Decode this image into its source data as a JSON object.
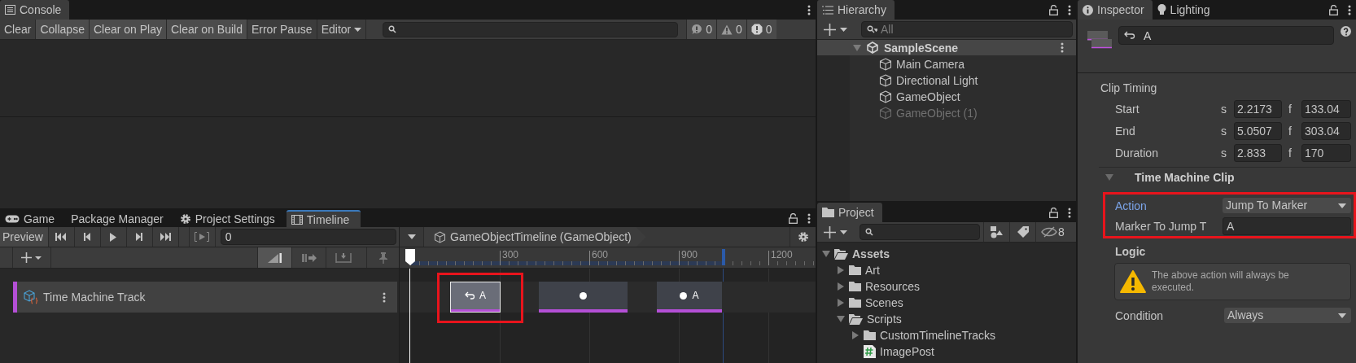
{
  "console": {
    "tab": "Console",
    "buttons": [
      {
        "label": "Clear",
        "on": false
      },
      {
        "label": "Collapse",
        "on": true
      },
      {
        "label": "Clear on Play",
        "on": true
      },
      {
        "label": "Clear on Build",
        "on": true
      },
      {
        "label": "Error Pause",
        "on": false
      }
    ],
    "editor": "Editor",
    "counts": [
      {
        "kind": "info",
        "count": "0"
      },
      {
        "kind": "warning",
        "count": "0"
      },
      {
        "kind": "error",
        "count": "0"
      }
    ]
  },
  "bottom_tabs": [
    {
      "label": "Game",
      "kind": "game",
      "selected": false
    },
    {
      "label": "Package Manager",
      "kind": "package",
      "selected": false
    },
    {
      "label": "Project Settings",
      "kind": "settings",
      "selected": false
    },
    {
      "label": "Timeline",
      "kind": "timeline",
      "selected": true
    }
  ],
  "timeline": {
    "preview": {
      "label": "Preview",
      "on": false
    },
    "time": "0",
    "asset": "GameObjectTimeline (GameObject)",
    "ruler_labels": [
      "300",
      "600",
      "900",
      "1200"
    ],
    "tracks": [
      {
        "name": "Time Machine Track",
        "color": "#b44fd6",
        "clips": [
          {
            "kind": "jump",
            "label": "A",
            "selected": true,
            "highlighted": true
          },
          {
            "kind": "marker",
            "selected": false,
            "highlighted": false
          },
          {
            "kind": "marker",
            "label": "A",
            "selected": false,
            "highlighted": false
          }
        ]
      }
    ]
  },
  "hierarchy": {
    "tab": "Hierarchy",
    "search": {
      "placeholder": "All"
    },
    "scene": {
      "name": "SampleScene",
      "expanded": true,
      "children": [
        {
          "name": "Main Camera",
          "disabled": false
        },
        {
          "name": "Directional Light",
          "disabled": false
        },
        {
          "name": "GameObject",
          "disabled": false
        },
        {
          "name": "GameObject (1)",
          "disabled": true
        }
      ]
    }
  },
  "project": {
    "tab": "Project",
    "hidden_count": "8",
    "tree": [
      {
        "name": "Assets",
        "kind": "folder",
        "expanded": true,
        "children": [
          {
            "name": "Art",
            "kind": "folder",
            "expanded": false
          },
          {
            "name": "Resources",
            "kind": "folder",
            "expanded": false
          },
          {
            "name": "Scenes",
            "kind": "folder",
            "expanded": false
          },
          {
            "name": "Scripts",
            "kind": "folder",
            "expanded": true,
            "children": [
              {
                "name": "CustomTimelineTracks",
                "kind": "folder",
                "expanded": false
              },
              {
                "name": "ImagePost",
                "kind": "script"
              }
            ]
          }
        ]
      }
    ]
  },
  "inspector": {
    "tabs": [
      {
        "label": "Inspector",
        "kind": "inspector",
        "selected": true
      },
      {
        "label": "Lighting",
        "kind": "lighting",
        "selected": false
      }
    ],
    "name": "A",
    "clip_timing": {
      "title": "Clip Timing",
      "rows": [
        {
          "label": "Start",
          "s_unit": "s",
          "s": "2.2173",
          "f_unit": "f",
          "f": "133.04"
        },
        {
          "label": "End",
          "s_unit": "s",
          "s": "5.0507",
          "f_unit": "f",
          "f": "303.04"
        },
        {
          "label": "Duration",
          "s_unit": "s",
          "s": "2.833",
          "f_unit": "f",
          "f": "170"
        }
      ]
    },
    "clip": {
      "title": "Time Machine Clip",
      "expanded": true,
      "highlighted": true,
      "action": {
        "label": "Action",
        "focused": true,
        "value": "Jump To Marker"
      },
      "marker": {
        "label": "Marker To Jump T",
        "value": "A"
      },
      "logic": {
        "title": "Logic",
        "warning": "The above action will always be executed."
      },
      "condition": {
        "label": "Condition",
        "value": "Always"
      }
    }
  }
}
